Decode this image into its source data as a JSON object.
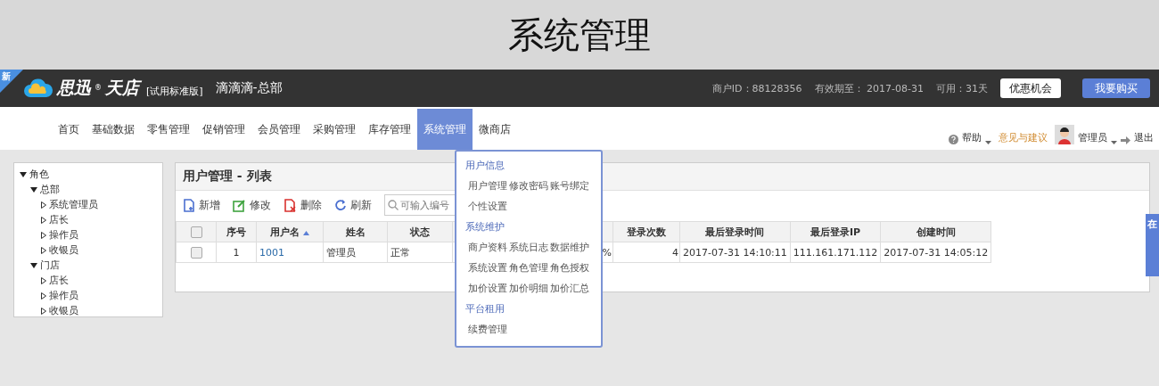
{
  "banner": {
    "title": "系统管理"
  },
  "header": {
    "corner_badge": "新",
    "logo": "思迅",
    "logo_mark": "®",
    "logo_name": "天店",
    "edition": "[试用标准版]",
    "store": "滴滴滴-总部",
    "merchant_id": "商户ID：88128356",
    "expiry": "有效期至： 2017-08-31",
    "available": "可用：31天",
    "buttons": [
      {
        "label": "优惠机会",
        "kind": "secondary"
      },
      {
        "label": "我要购买",
        "kind": "primary"
      }
    ]
  },
  "nav": {
    "items": [
      {
        "label": "首页",
        "selected": false
      },
      {
        "label": "基础数据",
        "selected": false
      },
      {
        "label": "零售管理",
        "selected": false
      },
      {
        "label": "促销管理",
        "selected": false
      },
      {
        "label": "会员管理",
        "selected": false
      },
      {
        "label": "采购管理",
        "selected": false
      },
      {
        "label": "库存管理",
        "selected": false
      },
      {
        "label": "系统管理",
        "selected": true
      },
      {
        "label": "微商店",
        "selected": false
      }
    ],
    "help": "帮助",
    "feedback": "意见与建议",
    "user": "管理员",
    "logout": "退出"
  },
  "dropdown": {
    "groups": [
      {
        "title": "用户信息",
        "items": [
          "用户管理",
          "修改密码",
          "账号绑定",
          "个性设置"
        ]
      },
      {
        "title": "系统维护",
        "items": [
          "商户资料",
          "系统日志",
          "数据维护",
          "系统设置",
          "角色管理",
          "角色授权",
          "加价设置",
          "加价明细",
          "加价汇总"
        ]
      },
      {
        "title": "平台租用",
        "items": [
          "续费管理"
        ]
      }
    ]
  },
  "tree": [
    {
      "label": "角色",
      "expanded": true,
      "children": [
        {
          "label": "总部",
          "expanded": true,
          "children": [
            {
              "label": "系统管理员",
              "expanded": false
            },
            {
              "label": "店长",
              "expanded": false
            },
            {
              "label": "操作员",
              "expanded": false
            },
            {
              "label": "收银员",
              "expanded": false
            }
          ]
        },
        {
          "label": "门店",
          "expanded": true,
          "children": [
            {
              "label": "店长",
              "expanded": false
            },
            {
              "label": "操作员",
              "expanded": false
            },
            {
              "label": "收银员",
              "expanded": false
            }
          ]
        }
      ]
    }
  ],
  "panel": {
    "title": "用户管理 - 列表",
    "toolbar": [
      {
        "label": "新增",
        "kind": "add"
      },
      {
        "label": "修改",
        "kind": "edit"
      },
      {
        "label": "删除",
        "kind": "delete"
      },
      {
        "label": "刷新",
        "kind": "refresh"
      }
    ],
    "search": {
      "placeholder": "可输入编号"
    },
    "table": {
      "select_all": {
        "checked": false
      },
      "columns": [
        {
          "label": "序号",
          "kind": "center"
        },
        {
          "label": "用户名",
          "kind": "text",
          "sort_ascending": true
        },
        {
          "label": "姓名",
          "kind": "text"
        },
        {
          "label": "状态",
          "kind": "text"
        },
        {
          "kind": "number"
        },
        {
          "label": "登录次数",
          "kind": "number"
        },
        {
          "label": "最后登录时间",
          "kind": "text"
        },
        {
          "label": "最后登录IP",
          "kind": "text"
        },
        {
          "label": "创建时间",
          "kind": "text"
        }
      ],
      "rows": [
        {
          "checked": false,
          "cells": [
            "1",
            "1001",
            "管理员",
            "正常",
            "%",
            "4",
            "2017-07-31 14:10:11",
            "111.161.171.112",
            "2017-07-31 14:05:12"
          ]
        }
      ]
    }
  },
  "side_tab": {
    "label": "在"
  }
}
